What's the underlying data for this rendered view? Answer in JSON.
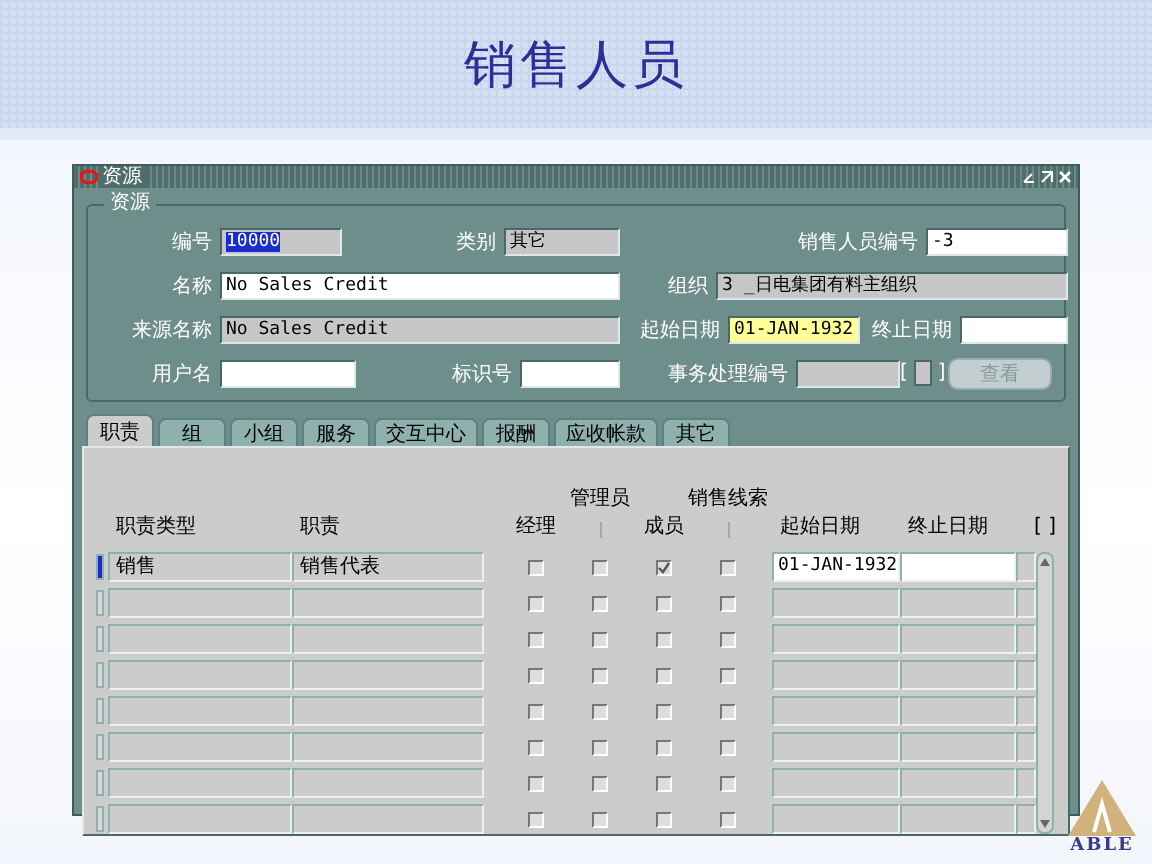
{
  "slide": {
    "title": "销售人员",
    "logo_text": "ABLE"
  },
  "window": {
    "title": "资源"
  },
  "resource_group": {
    "title": "资源",
    "rows": [
      {
        "fields": [
          {
            "label": "编号",
            "value": "10000",
            "kind": "readonly",
            "text_selected": true
          },
          {
            "label": "类别",
            "value": "其它",
            "kind": "readonly",
            "text_selected": false
          },
          {
            "label": "销售人员编号",
            "value": "-3",
            "kind": "editable",
            "text_selected": false
          }
        ]
      },
      {
        "fields": [
          {
            "label": "名称",
            "value": "No Sales Credit",
            "kind": "editable",
            "text_selected": false
          },
          {
            "label": "组织",
            "value": "3 _日电集团有料主组织",
            "kind": "readonly",
            "text_selected": false
          }
        ]
      },
      {
        "fields": [
          {
            "label": "来源名称",
            "value": "No Sales Credit",
            "kind": "readonly",
            "text_selected": false
          },
          {
            "label": "起始日期",
            "value": "01-JAN-1932",
            "kind": "current",
            "text_selected": false
          },
          {
            "label": "终止日期",
            "kind": "editable"
          }
        ]
      },
      {
        "fields": [
          {
            "label": "用户名",
            "kind": "editable"
          },
          {
            "label": "标识号",
            "kind": "editable"
          },
          {
            "label": "事务处理编号",
            "kind": "readonly"
          }
        ]
      }
    ],
    "record_field": {
      "open": "[",
      "close": "]"
    },
    "button": {
      "label": "查看",
      "disabled": true
    }
  },
  "tabs": [
    {
      "label": "职责",
      "selected": true
    },
    {
      "label": "组",
      "selected": false
    },
    {
      "label": "小组",
      "selected": false
    },
    {
      "label": "服务",
      "selected": false
    },
    {
      "label": "交互中心",
      "selected": false
    },
    {
      "label": "报酬",
      "selected": false
    },
    {
      "label": "应收帐款",
      "selected": false
    },
    {
      "label": "其它",
      "selected": false
    }
  ],
  "table": {
    "columns": [
      {
        "label": "职责类型"
      },
      {
        "label": "职责"
      },
      {
        "label": "经理"
      },
      {
        "group_label": "管理员"
      },
      {
        "label": "成员"
      },
      {
        "group_label": "销售线索"
      },
      {
        "label": "起始日期"
      },
      {
        "label": "终止日期"
      },
      {
        "label": "[ ]"
      }
    ],
    "rows": [
      {
        "selected": true,
        "type": "销售",
        "duty": "销售代表",
        "checks": [
          false,
          false,
          true,
          false
        ],
        "start": "01-JAN-1932"
      },
      {
        "selected": false,
        "checks": [
          false,
          false,
          false,
          false
        ]
      },
      {
        "selected": false,
        "checks": [
          false,
          false,
          false,
          false
        ]
      },
      {
        "selected": false,
        "checks": [
          false,
          false,
          false,
          false
        ]
      },
      {
        "selected": false,
        "checks": [
          false,
          false,
          false,
          false
        ]
      },
      {
        "selected": false,
        "checks": [
          false,
          false,
          false,
          false
        ]
      },
      {
        "selected": false,
        "checks": [
          false,
          false,
          false,
          false
        ]
      },
      {
        "selected": false,
        "checks": [
          false,
          false,
          false,
          false
        ]
      }
    ]
  }
}
